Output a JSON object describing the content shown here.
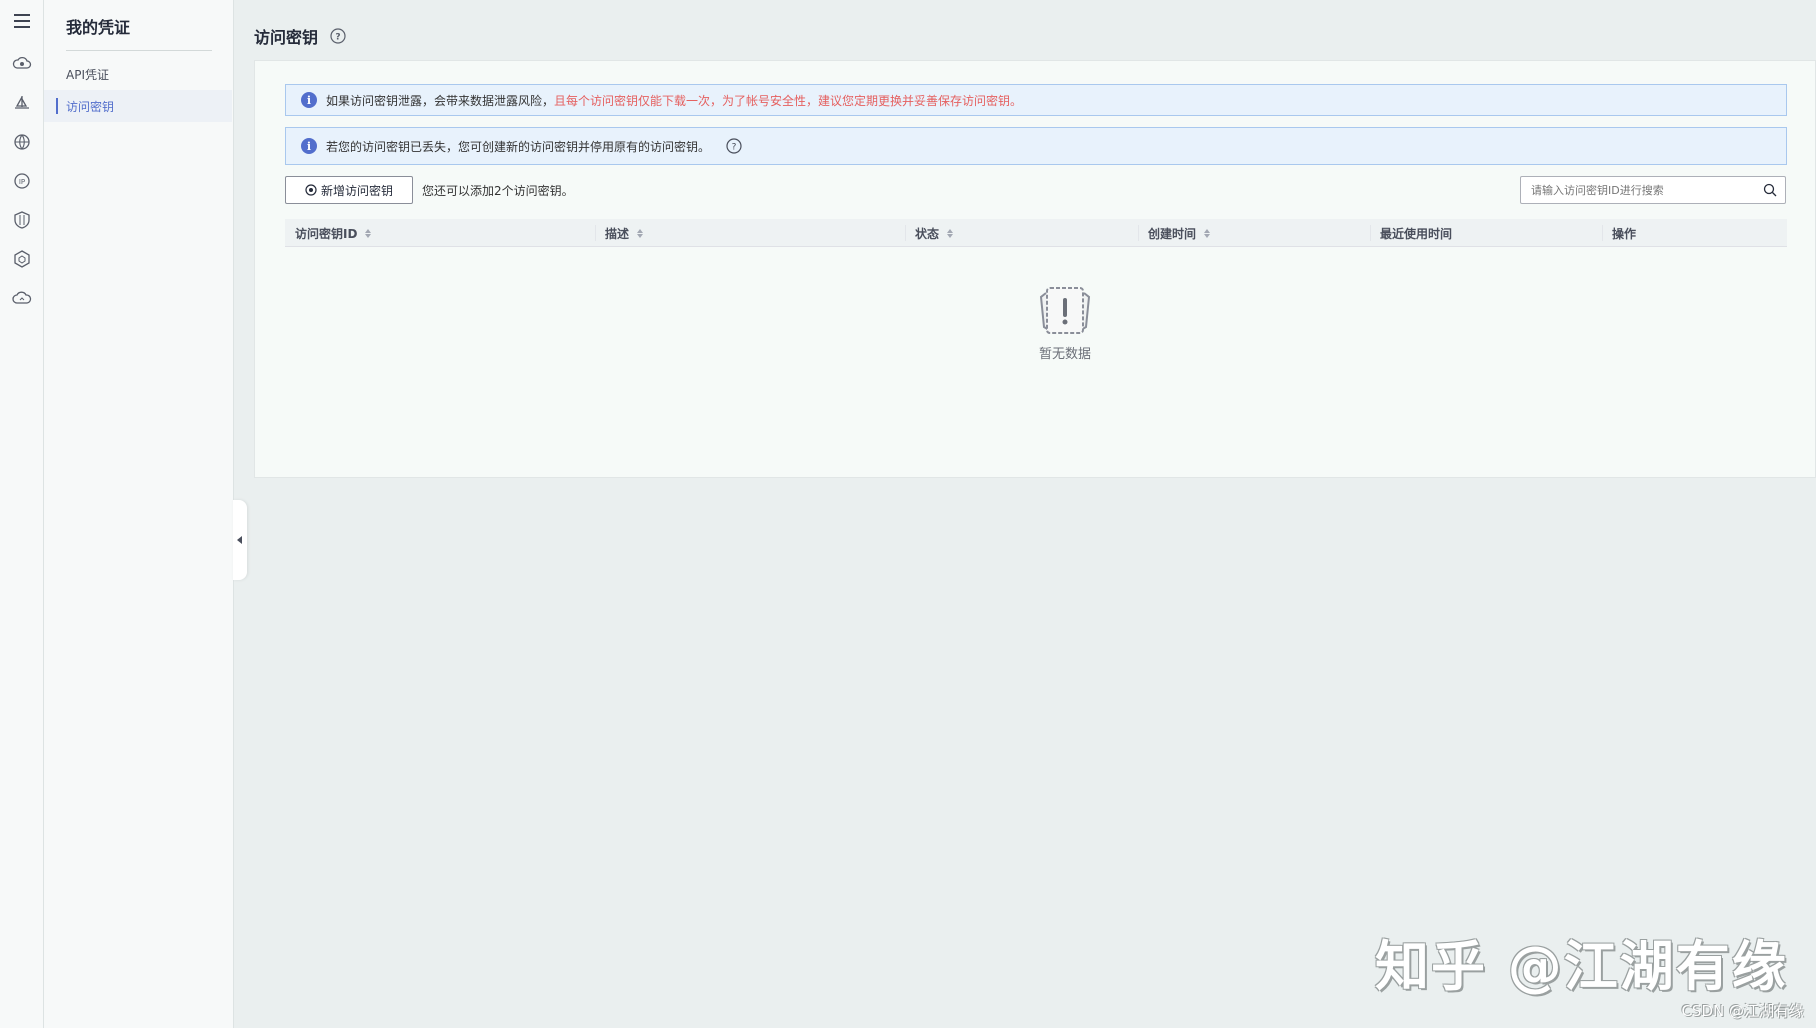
{
  "sidebar": {
    "title": "我的凭证",
    "items": [
      {
        "label": "API凭证",
        "active": false
      },
      {
        "label": "访问密钥",
        "active": true
      }
    ]
  },
  "rail_icons": [
    "menu-icon",
    "cloud-eye-icon",
    "sailboat-icon",
    "globe-icon",
    "ip-icon",
    "shield-icon",
    "cube-icon",
    "cloud-icon"
  ],
  "page": {
    "title": "访问密钥"
  },
  "alerts": [
    {
      "text": "如果访问密钥泄露，会带来数据泄露风险，",
      "warning": "且每个访问密钥仅能下载一次，为了帐号安全性，建议您定期更换并妥善保存访问密钥。"
    },
    {
      "text": "若您的访问密钥已丢失，您可创建新的访问密钥并停用原有的访问密钥。",
      "warning": ""
    }
  ],
  "toolbar": {
    "add_label": "新增访问密钥",
    "quota_text": "您还可以添加2个访问密钥。",
    "search_placeholder": "请输入访问密钥ID进行搜索"
  },
  "table": {
    "columns": [
      {
        "label": "访问密钥ID",
        "sortable": true
      },
      {
        "label": "描述",
        "sortable": true
      },
      {
        "label": "状态",
        "sortable": true
      },
      {
        "label": "创建时间",
        "sortable": true
      },
      {
        "label": "最近使用时间",
        "sortable": false
      },
      {
        "label": "操作",
        "sortable": false
      }
    ],
    "rows": [],
    "empty_text": "暂无数据"
  },
  "watermark": {
    "main": "知乎 @江湖有缘",
    "csdn": "CSDN @江湖有缘"
  },
  "colors": {
    "accent": "#526ecc",
    "warning": "#e5605f",
    "alert_bg": "#e8f2fc"
  }
}
